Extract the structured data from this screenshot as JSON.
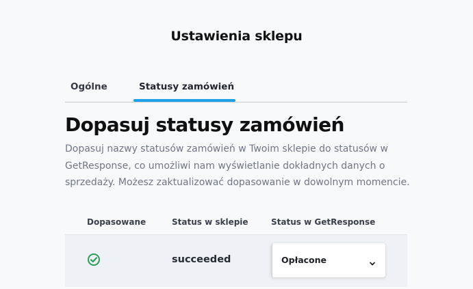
{
  "page": {
    "title": "Ustawienia sklepu"
  },
  "tabs": [
    {
      "label": "Ogólne",
      "active": false
    },
    {
      "label": "Statusy zamówień",
      "active": true
    }
  ],
  "section": {
    "heading": "Dopasuj statusy zamówień",
    "description": "Dopasuj nazwy statusów zamówień w Twoim sklepie do statusów w GetResponse, co umożliwi nam wyświetlanie dokładnych danych o sprzedaży. Możesz zaktualizować dopasowanie w dowolnym momencie."
  },
  "table": {
    "columns": [
      "Dopasowane",
      "Status w sklepie",
      "Status w GetResponse"
    ],
    "rows": [
      {
        "matched_icon": "check-circle-icon",
        "shop_status": "succeeded",
        "getresponse_status": "Opłacone"
      }
    ]
  },
  "colors": {
    "accent": "#1ba1ea",
    "success": "#2e9e57",
    "muted_text": "#6f7684"
  }
}
